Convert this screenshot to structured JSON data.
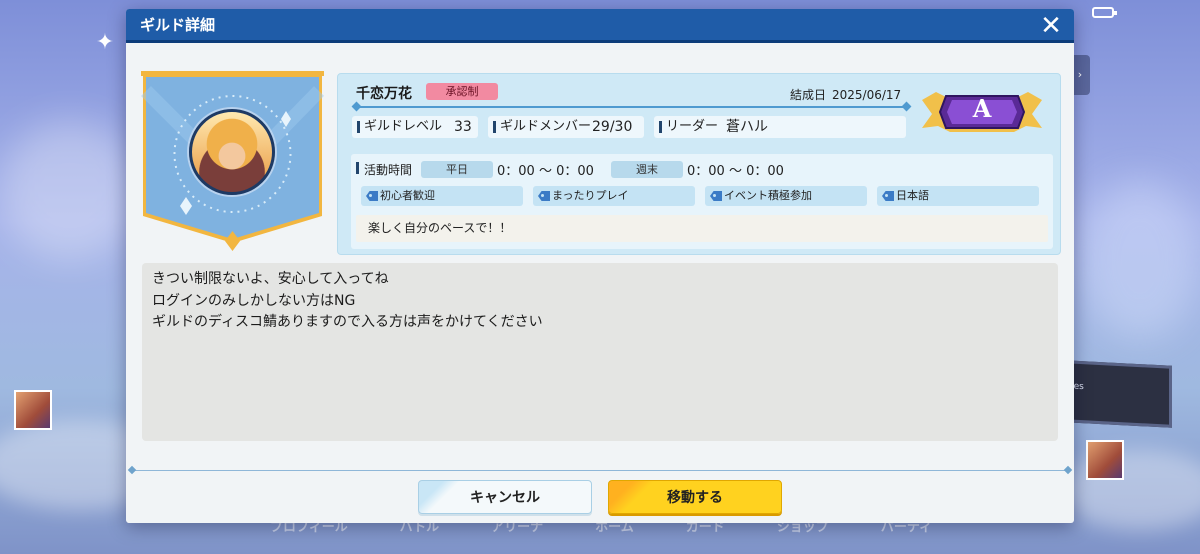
{
  "background": {
    "nav_items": [
      "プロフィール",
      "バトル",
      "アリーナ",
      "ホーム",
      "カード",
      "ショップ",
      "パーティ"
    ],
    "billboard_text": "Cygames"
  },
  "modal": {
    "title": "ギルド詳細",
    "close_icon": "close-icon"
  },
  "guild": {
    "name": "千恋万花",
    "join_type": "承認制",
    "founded_label": "結成日",
    "founded_date": "2025/06/17",
    "rank": "A",
    "level_label": "ギルドレベル",
    "level_value": "33",
    "members_label": "ギルドメンバー",
    "members_value": "29/30",
    "leader_label": "リーダー",
    "leader_value": "蒼ハル",
    "activity_label": "活動時間",
    "weekday_label": "平日",
    "weekday_time": "0：00 ～ 0：00",
    "weekend_label": "週末",
    "weekend_time": "0：00 ～ 0：00",
    "tags": [
      "初心者歓迎",
      "まったりプレイ",
      "イベント積極参加",
      "日本語"
    ],
    "motto": "楽しく自分のペースで！！",
    "description": [
      "きつい制限ないよ、安心して入ってね",
      "ログインのみしかしない方はNG",
      "ギルドのディスコ鯖ありますので入る方は声をかけてください"
    ]
  },
  "buttons": {
    "cancel": "キャンセル",
    "move": "移動する"
  },
  "colors": {
    "header": "#1f5ca8",
    "panel": "#cfe9f6",
    "approval_badge": "#f28aa1",
    "move_button": "#ffd21f",
    "rank_badge": "#7a3fc0"
  }
}
